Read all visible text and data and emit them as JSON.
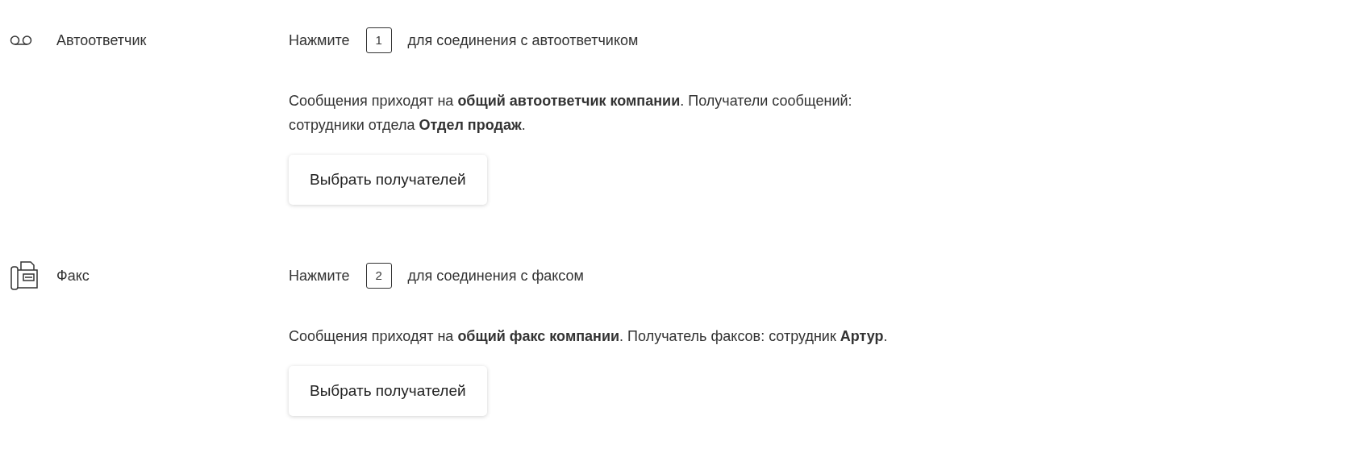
{
  "sections": [
    {
      "kind": "voicemail",
      "label": "Автоответчик",
      "press_before": "Нажмите",
      "key": "1",
      "press_after": "для соединения с автоответчиком",
      "description_lines": [
        "Сообщения приходят на **общий автоответчик компании**. Получатели сообщений:",
        "сотрудники отдела **Отдел продаж**."
      ],
      "button": "Выбрать получателей"
    },
    {
      "kind": "fax",
      "label": "Факс",
      "press_before": "Нажмите",
      "key": "2",
      "press_after": "для соединения с факсом",
      "description_lines": [
        "Сообщения приходят на **общий факс компании**. Получатель факсов: сотрудник **Артур**."
      ],
      "button": "Выбрать получателей"
    }
  ]
}
